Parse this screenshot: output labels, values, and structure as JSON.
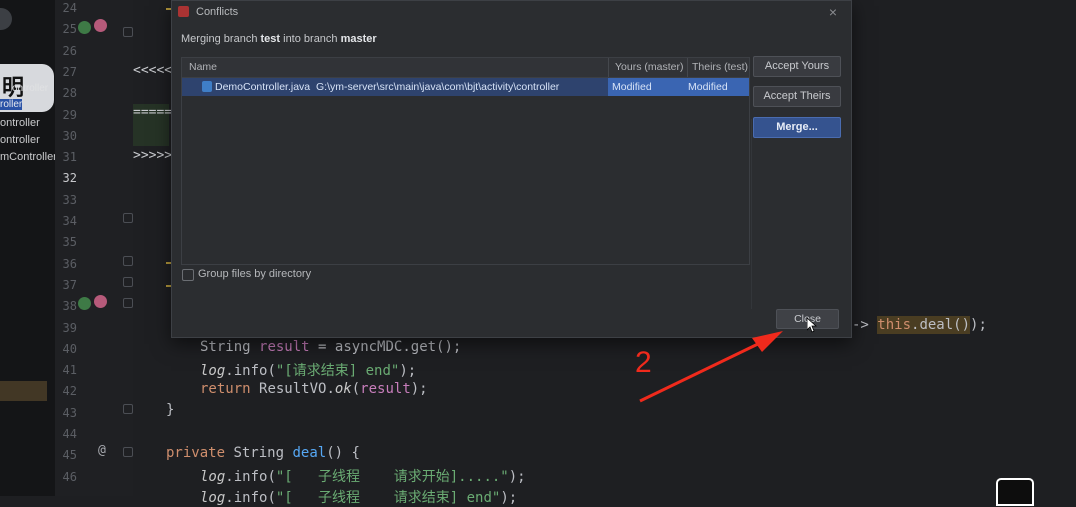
{
  "left_panel": {
    "bubble_text": "明",
    "items": [
      "ontroller",
      "roller",
      "ontroller",
      "ontroller",
      "mController"
    ]
  },
  "gutter": {
    "line_numbers": [
      "24",
      "25",
      "26",
      "27",
      "28",
      "29",
      "30",
      "31",
      "32",
      "33",
      "34",
      "35",
      "36",
      "37",
      "38",
      "39",
      "40",
      "41",
      "42",
      "43",
      "44",
      "45",
      "46"
    ],
    "current_line": "32",
    "at_marker": "@"
  },
  "editor": {
    "conflict_markers": {
      "start": "<<<<<",
      "middle": "=====",
      "end": ">>>>>"
    },
    "line39_tail": {
      "arrow": "->",
      "keyword": "this",
      "call": ".deal()",
      "end": ");"
    },
    "line40": {
      "type": "String",
      "var": "result",
      "op": "=",
      "call": "asyncMDC.get();"
    },
    "line41": {
      "obj": "log",
      "method": ".info(",
      "str": "\"[请求结束] end\"",
      "end": ");"
    },
    "line42": {
      "keyword": "return",
      "cls": "ResultVO.",
      "method": "ok",
      "arg": "result",
      "end": ");"
    },
    "line43": {
      "brace": "}"
    },
    "line45": {
      "mod": "private",
      "type": "String",
      "fn": "deal",
      "sig": "() {"
    },
    "line46": {
      "obj": "log",
      "method": ".info(",
      "str": "\"[   子线程    请求开始].....\"",
      "end": ");"
    },
    "line47": {
      "obj": "log",
      "method": ".info(",
      "str": "\"[   子线程    请求结束] end\"",
      "end": ");"
    }
  },
  "dialog": {
    "title": "Conflicts",
    "close_glyph": "×",
    "subtitle_prefix": "Merging branch ",
    "subtitle_branch_from": "test",
    "subtitle_middle": " into branch ",
    "subtitle_branch_to": "master",
    "table": {
      "headers": {
        "name": "Name",
        "yours": "Yours (master)",
        "theirs": "Theirs (test)"
      },
      "rows": [
        {
          "file": "DemoController.java",
          "path": "G:\\ym-server\\src\\main\\java\\com\\bjt\\activity\\controller",
          "yours": "Modified",
          "theirs": "Modified"
        }
      ]
    },
    "group_files_label": "Group files by directory",
    "buttons": {
      "accept_yours": "Accept Yours",
      "accept_theirs": "Accept Theirs",
      "merge": "Merge...",
      "close": "Close"
    }
  },
  "annotation": {
    "number": "2",
    "color": "#f02a1c"
  }
}
